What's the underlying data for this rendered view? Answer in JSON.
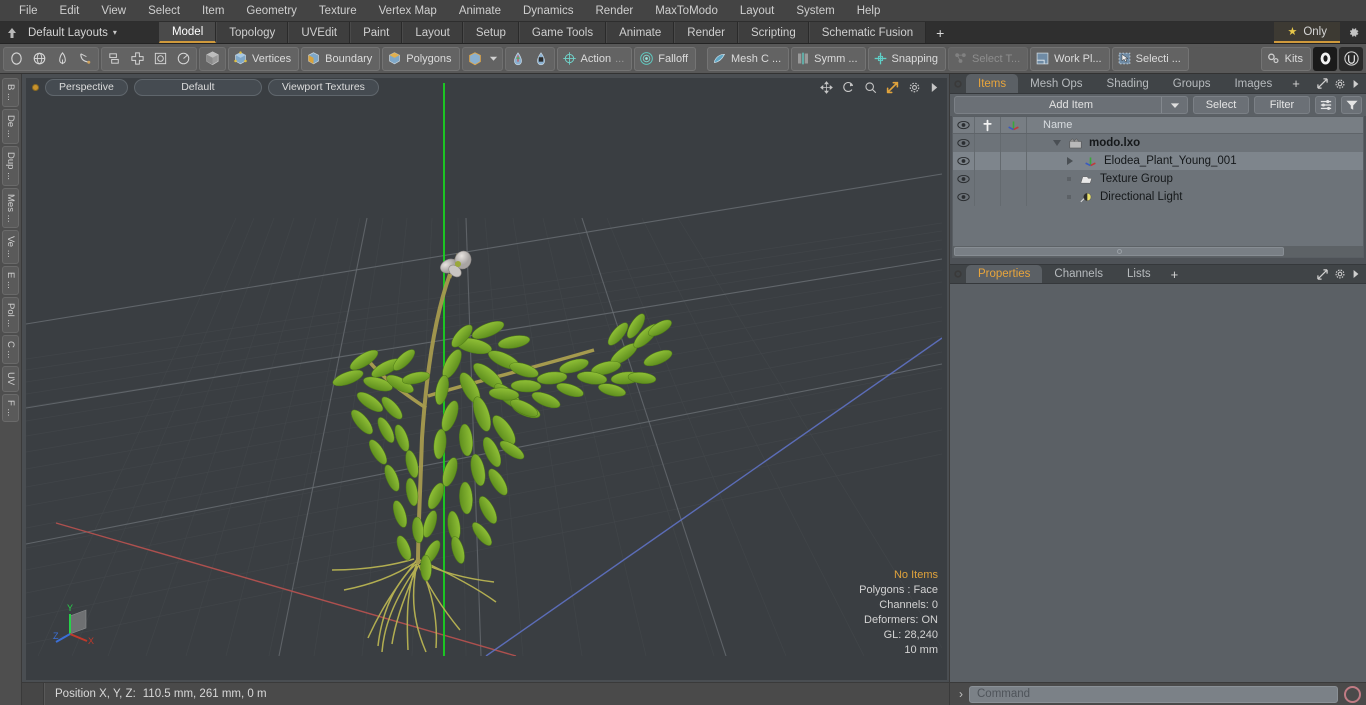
{
  "app": {
    "title": "modo",
    "bg_viewport": "#3a3e42",
    "accent": "#d09a3c"
  },
  "menubar": {
    "items": [
      "File",
      "Edit",
      "View",
      "Select",
      "Item",
      "Geometry",
      "Texture",
      "Vertex Map",
      "Animate",
      "Dynamics",
      "Render",
      "MaxToModo",
      "Layout",
      "System",
      "Help"
    ]
  },
  "layoutbar": {
    "home_icon": "home-layout-icon",
    "layout_name": "Default Layouts",
    "caret": "▾",
    "tabs": [
      {
        "label": "Model",
        "active": true
      },
      {
        "label": "Topology",
        "active": false
      },
      {
        "label": "UVEdit",
        "active": false
      },
      {
        "label": "Paint",
        "active": false
      },
      {
        "label": "Layout",
        "active": false
      },
      {
        "label": "Setup",
        "active": false
      },
      {
        "label": "Game Tools",
        "active": false
      },
      {
        "label": "Animate",
        "active": false
      },
      {
        "label": "Render",
        "active": false
      },
      {
        "label": "Scripting",
        "active": false
      },
      {
        "label": "Schematic Fusion",
        "active": false
      }
    ],
    "add_tab": "+",
    "only_label": "Only",
    "only_star": "★",
    "gear_icon": "gear-icon"
  },
  "modebar": {
    "primitive_icons": [
      "circle-icon",
      "globe-icon",
      "pen-icon",
      "curve-icon"
    ],
    "transform_icons": [
      "align-icon",
      "center-icon",
      "bound-icon",
      "radial-icon"
    ],
    "cube_icon": "cube-icon",
    "selection_modes": [
      {
        "label": "Vertices",
        "icon": "vertices-icon"
      },
      {
        "label": "Boundary",
        "icon": "boundary-icon"
      },
      {
        "label": "Polygons",
        "icon": "polygons-icon"
      }
    ],
    "item_mode_icon": "item-mode-icon",
    "item_mode_caret": "▾",
    "pivot_icons": [
      "pivot-a-icon",
      "pivot-b-icon"
    ],
    "action_label": "Action",
    "action_more": "...",
    "falloff_label": "Falloff",
    "mesh_constraint_label": "Mesh C ...",
    "symmetry_label": "Symm ...",
    "snapping_label": "Snapping",
    "select_through_label": "Select T...",
    "work_plane_label": "Work Pl...",
    "selection_label": "Selecti ...",
    "kits_label": "Kits",
    "app_icons": [
      "modo-ball-icon",
      "unreal-icon"
    ]
  },
  "left_tabs": {
    "items": [
      "B ...",
      "De ...",
      "Dup ...",
      "Mes ...",
      "Ve ...",
      "E ...",
      "Pol ...",
      "C ...",
      "UV",
      "F ..."
    ]
  },
  "viewport": {
    "dot": "viewport-indicator-dot",
    "buttons": [
      "Perspective",
      "Default",
      "Viewport Textures"
    ],
    "tool_icons": [
      "pan-icon",
      "rotate-icon",
      "zoom-icon",
      "fit-icon",
      "gear-icon",
      "chevron-right-icon"
    ],
    "stats": {
      "selection": "No Items",
      "polygons": "Polygons : Face",
      "channels": "Channels: 0",
      "deformers": "Deformers: ON",
      "gl": "GL: 28,240",
      "grid": "10 mm"
    },
    "axis_labels": {
      "x": "X",
      "y": "Y",
      "z": "Z"
    },
    "axis_colors": {
      "x": "#c0392b",
      "y": "#27d14a",
      "z": "#3b6fd6"
    }
  },
  "statusbar": {
    "label": "Position X, Y, Z:",
    "value": "110.5 mm, 261 mm, 0 m"
  },
  "rightpanel": {
    "tabs": [
      {
        "label": "Items",
        "active": true
      },
      {
        "label": "Mesh Ops",
        "active": false
      },
      {
        "label": "Shading",
        "active": false
      },
      {
        "label": "Groups",
        "active": false
      },
      {
        "label": "Images",
        "active": false
      }
    ],
    "add_tab": "+",
    "panel_tools": [
      "expand-icon",
      "gear-icon",
      "chevron-right-icon"
    ],
    "toolbar": {
      "add_item": "Add Item",
      "add_item_caret": "▾",
      "select": "Select",
      "filter": "Filter",
      "list_options_icon": "list-options-icon",
      "funnel_icon": "funnel-icon"
    },
    "list": {
      "columns": [
        "eye-icon",
        "lock-icon",
        "transform-icon",
        "Name"
      ],
      "rows": [
        {
          "name": "modo.lxo",
          "icon": "scene-icon",
          "indent": 0,
          "expanded": true,
          "bold": true,
          "selected": false
        },
        {
          "name": "Elodea_Plant_Young_001",
          "icon": "mesh-item-icon",
          "indent": 1,
          "expanded": false,
          "bold": false,
          "selected": true
        },
        {
          "name": "Texture Group",
          "icon": "texture-group-icon",
          "indent": 2,
          "expanded": null,
          "bold": false,
          "selected": false
        },
        {
          "name": "Directional Light",
          "icon": "directional-light-icon",
          "indent": 2,
          "expanded": null,
          "bold": false,
          "selected": false
        }
      ]
    },
    "properties_tabs": [
      {
        "label": "Properties",
        "active": true
      },
      {
        "label": "Channels",
        "active": false
      },
      {
        "label": "Lists",
        "active": false
      }
    ],
    "properties_add_tab": "+"
  },
  "commandbar": {
    "arrow": "›",
    "placeholder": "Command",
    "value": "",
    "record_icon": "record-icon"
  }
}
